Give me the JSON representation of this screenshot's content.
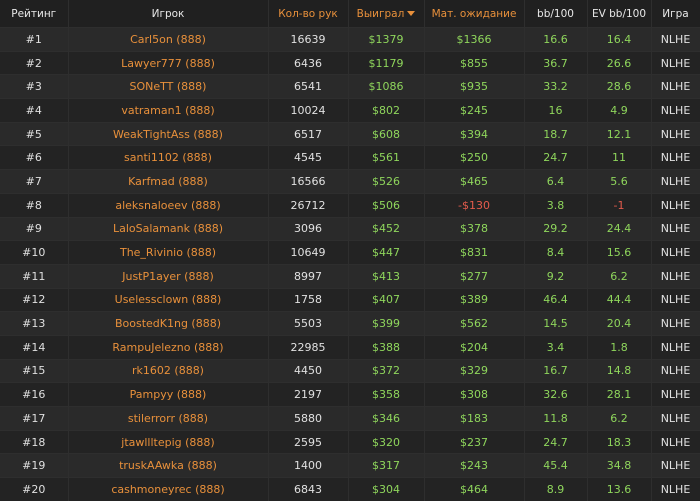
{
  "headers": [
    "Рейтинг",
    "Игрок",
    "Кол-во рук",
    "Выиграл",
    "Мат. ожидание",
    "bb/100",
    "EV bb/100",
    "Игра"
  ],
  "colors": {
    "accent": "#e8903b",
    "positive": "#8fd65c",
    "negative": "#e35b4c"
  },
  "rows": [
    [
      "#1",
      "Carl5on (888)",
      "16639",
      "$1379",
      "$1366",
      "16.6",
      "16.4",
      "NLHE"
    ],
    [
      "#2",
      "Lawyer777 (888)",
      "6436",
      "$1179",
      "$855",
      "36.7",
      "26.6",
      "NLHE"
    ],
    [
      "#3",
      "SONeTT (888)",
      "6541",
      "$1086",
      "$935",
      "33.2",
      "28.6",
      "NLHE"
    ],
    [
      "#4",
      "vatraman1 (888)",
      "10024",
      "$802",
      "$245",
      "16",
      "4.9",
      "NLHE"
    ],
    [
      "#5",
      "WeakTightAss (888)",
      "6517",
      "$608",
      "$394",
      "18.7",
      "12.1",
      "NLHE"
    ],
    [
      "#6",
      "santi1102 (888)",
      "4545",
      "$561",
      "$250",
      "24.7",
      "11",
      "NLHE"
    ],
    [
      "#7",
      "Karfmad (888)",
      "16566",
      "$526",
      "$465",
      "6.4",
      "5.6",
      "NLHE"
    ],
    [
      "#8",
      "aleksnaloeev (888)",
      "26712",
      "$506",
      "-$130",
      "3.8",
      "-1",
      "NLHE"
    ],
    [
      "#9",
      "LaloSalamank (888)",
      "3096",
      "$452",
      "$378",
      "29.2",
      "24.4",
      "NLHE"
    ],
    [
      "#10",
      "The_Rivinio (888)",
      "10649",
      "$447",
      "$831",
      "8.4",
      "15.6",
      "NLHE"
    ],
    [
      "#11",
      "JustP1ayer (888)",
      "8997",
      "$413",
      "$277",
      "9.2",
      "6.2",
      "NLHE"
    ],
    [
      "#12",
      "Uselessclown (888)",
      "1758",
      "$407",
      "$389",
      "46.4",
      "44.4",
      "NLHE"
    ],
    [
      "#13",
      "BoostedK1ng (888)",
      "5503",
      "$399",
      "$562",
      "14.5",
      "20.4",
      "NLHE"
    ],
    [
      "#14",
      "RampuJelezno (888)",
      "22985",
      "$388",
      "$204",
      "3.4",
      "1.8",
      "NLHE"
    ],
    [
      "#15",
      "rk1602 (888)",
      "4450",
      "$372",
      "$329",
      "16.7",
      "14.8",
      "NLHE"
    ],
    [
      "#16",
      "Pampyy (888)",
      "2197",
      "$358",
      "$308",
      "32.6",
      "28.1",
      "NLHE"
    ],
    [
      "#17",
      "stilerrorr (888)",
      "5880",
      "$346",
      "$183",
      "11.8",
      "6.2",
      "NLHE"
    ],
    [
      "#18",
      "jtawllltepig (888)",
      "2595",
      "$320",
      "$237",
      "24.7",
      "18.3",
      "NLHE"
    ],
    [
      "#19",
      "truskAAwka (888)",
      "1400",
      "$317",
      "$243",
      "45.4",
      "34.8",
      "NLHE"
    ],
    [
      "#20",
      "cashmoneyrec (888)",
      "6843",
      "$304",
      "$464",
      "8.9",
      "13.6",
      "NLHE"
    ]
  ]
}
